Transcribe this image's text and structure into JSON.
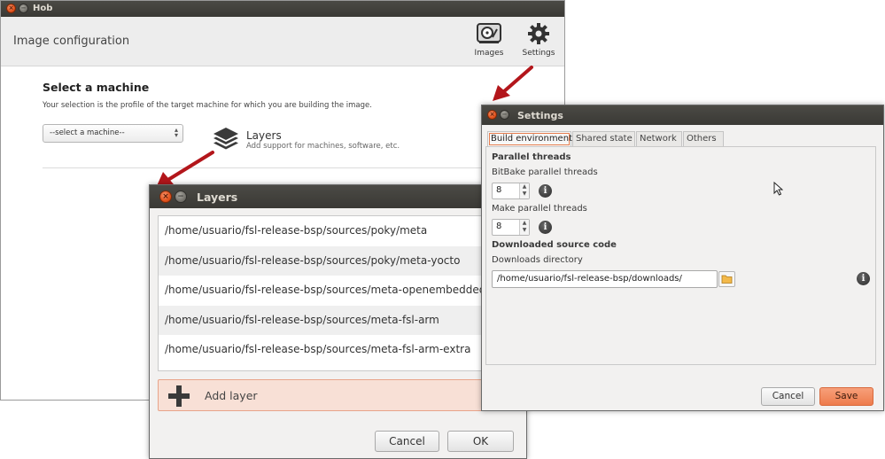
{
  "hob": {
    "title": "Hob",
    "header_title": "Image configuration",
    "tools": [
      {
        "label": "Images",
        "icon": "hard-disk-icon"
      },
      {
        "label": "Settings",
        "icon": "gear-icon"
      }
    ],
    "machine_title": "Select a machine",
    "machine_desc": "Your selection is the profile of the target machine for which you are building the image.",
    "machine_select_value": "--select a machine--",
    "layers_label": "Layers",
    "layers_desc": "Add support for machines, software, etc."
  },
  "layers_dialog": {
    "title": "Layers",
    "rows": [
      "/home/usuario/fsl-release-bsp/sources/poky/meta",
      "/home/usuario/fsl-release-bsp/sources/poky/meta-yocto",
      "/home/usuario/fsl-release-bsp/sources/meta-openembedded/meta-oe",
      "/home/usuario/fsl-release-bsp/sources/meta-fsl-arm",
      "/home/usuario/fsl-release-bsp/sources/meta-fsl-arm-extra"
    ],
    "add_layer_label": "Add layer",
    "cancel_label": "Cancel",
    "ok_label": "OK"
  },
  "settings_dialog": {
    "title": "Settings",
    "tabs": [
      "Build environment",
      "Shared state",
      "Network",
      "Others"
    ],
    "active_tab": "Build environment",
    "parallel_threads_heading": "Parallel threads",
    "bitbake_threads_label": "BitBake parallel threads",
    "bitbake_threads_value": "8",
    "make_threads_label": "Make parallel threads",
    "make_threads_value": "8",
    "downloaded_source_heading": "Downloaded source code",
    "downloads_dir_label": "Downloads directory",
    "downloads_dir_value": "/home/usuario/fsl-release-bsp/downloads/",
    "cancel_label": "Cancel",
    "save_label": "Save"
  },
  "colors": {
    "titlebar": "#3c3b37",
    "accent_orange": "#ee7b4c",
    "annotation_arrow": "#b3161b",
    "add_layer_bg": "#f8e0d6"
  }
}
